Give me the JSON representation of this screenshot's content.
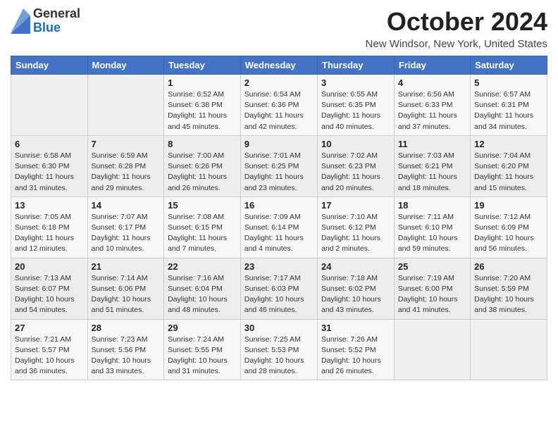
{
  "header": {
    "logo": {
      "general": "General",
      "blue": "Blue"
    },
    "title": "October 2024",
    "location": "New Windsor, New York, United States"
  },
  "weekdays": [
    "Sunday",
    "Monday",
    "Tuesday",
    "Wednesday",
    "Thursday",
    "Friday",
    "Saturday"
  ],
  "weeks": [
    [
      null,
      null,
      {
        "day": 1,
        "sunrise": "Sunrise: 6:52 AM",
        "sunset": "Sunset: 6:38 PM",
        "daylight": "Daylight: 11 hours and 45 minutes."
      },
      {
        "day": 2,
        "sunrise": "Sunrise: 6:54 AM",
        "sunset": "Sunset: 6:36 PM",
        "daylight": "Daylight: 11 hours and 42 minutes."
      },
      {
        "day": 3,
        "sunrise": "Sunrise: 6:55 AM",
        "sunset": "Sunset: 6:35 PM",
        "daylight": "Daylight: 11 hours and 40 minutes."
      },
      {
        "day": 4,
        "sunrise": "Sunrise: 6:56 AM",
        "sunset": "Sunset: 6:33 PM",
        "daylight": "Daylight: 11 hours and 37 minutes."
      },
      {
        "day": 5,
        "sunrise": "Sunrise: 6:57 AM",
        "sunset": "Sunset: 6:31 PM",
        "daylight": "Daylight: 11 hours and 34 minutes."
      }
    ],
    [
      {
        "day": 6,
        "sunrise": "Sunrise: 6:58 AM",
        "sunset": "Sunset: 6:30 PM",
        "daylight": "Daylight: 11 hours and 31 minutes."
      },
      {
        "day": 7,
        "sunrise": "Sunrise: 6:59 AM",
        "sunset": "Sunset: 6:28 PM",
        "daylight": "Daylight: 11 hours and 29 minutes."
      },
      {
        "day": 8,
        "sunrise": "Sunrise: 7:00 AM",
        "sunset": "Sunset: 6:26 PM",
        "daylight": "Daylight: 11 hours and 26 minutes."
      },
      {
        "day": 9,
        "sunrise": "Sunrise: 7:01 AM",
        "sunset": "Sunset: 6:25 PM",
        "daylight": "Daylight: 11 hours and 23 minutes."
      },
      {
        "day": 10,
        "sunrise": "Sunrise: 7:02 AM",
        "sunset": "Sunset: 6:23 PM",
        "daylight": "Daylight: 11 hours and 20 minutes."
      },
      {
        "day": 11,
        "sunrise": "Sunrise: 7:03 AM",
        "sunset": "Sunset: 6:21 PM",
        "daylight": "Daylight: 11 hours and 18 minutes."
      },
      {
        "day": 12,
        "sunrise": "Sunrise: 7:04 AM",
        "sunset": "Sunset: 6:20 PM",
        "daylight": "Daylight: 11 hours and 15 minutes."
      }
    ],
    [
      {
        "day": 13,
        "sunrise": "Sunrise: 7:05 AM",
        "sunset": "Sunset: 6:18 PM",
        "daylight": "Daylight: 11 hours and 12 minutes."
      },
      {
        "day": 14,
        "sunrise": "Sunrise: 7:07 AM",
        "sunset": "Sunset: 6:17 PM",
        "daylight": "Daylight: 11 hours and 10 minutes."
      },
      {
        "day": 15,
        "sunrise": "Sunrise: 7:08 AM",
        "sunset": "Sunset: 6:15 PM",
        "daylight": "Daylight: 11 hours and 7 minutes."
      },
      {
        "day": 16,
        "sunrise": "Sunrise: 7:09 AM",
        "sunset": "Sunset: 6:14 PM",
        "daylight": "Daylight: 11 hours and 4 minutes."
      },
      {
        "day": 17,
        "sunrise": "Sunrise: 7:10 AM",
        "sunset": "Sunset: 6:12 PM",
        "daylight": "Daylight: 11 hours and 2 minutes."
      },
      {
        "day": 18,
        "sunrise": "Sunrise: 7:11 AM",
        "sunset": "Sunset: 6:10 PM",
        "daylight": "Daylight: 10 hours and 59 minutes."
      },
      {
        "day": 19,
        "sunrise": "Sunrise: 7:12 AM",
        "sunset": "Sunset: 6:09 PM",
        "daylight": "Daylight: 10 hours and 56 minutes."
      }
    ],
    [
      {
        "day": 20,
        "sunrise": "Sunrise: 7:13 AM",
        "sunset": "Sunset: 6:07 PM",
        "daylight": "Daylight: 10 hours and 54 minutes."
      },
      {
        "day": 21,
        "sunrise": "Sunrise: 7:14 AM",
        "sunset": "Sunset: 6:06 PM",
        "daylight": "Daylight: 10 hours and 51 minutes."
      },
      {
        "day": 22,
        "sunrise": "Sunrise: 7:16 AM",
        "sunset": "Sunset: 6:04 PM",
        "daylight": "Daylight: 10 hours and 48 minutes."
      },
      {
        "day": 23,
        "sunrise": "Sunrise: 7:17 AM",
        "sunset": "Sunset: 6:03 PM",
        "daylight": "Daylight: 10 hours and 46 minutes."
      },
      {
        "day": 24,
        "sunrise": "Sunrise: 7:18 AM",
        "sunset": "Sunset: 6:02 PM",
        "daylight": "Daylight: 10 hours and 43 minutes."
      },
      {
        "day": 25,
        "sunrise": "Sunrise: 7:19 AM",
        "sunset": "Sunset: 6:00 PM",
        "daylight": "Daylight: 10 hours and 41 minutes."
      },
      {
        "day": 26,
        "sunrise": "Sunrise: 7:20 AM",
        "sunset": "Sunset: 5:59 PM",
        "daylight": "Daylight: 10 hours and 38 minutes."
      }
    ],
    [
      {
        "day": 27,
        "sunrise": "Sunrise: 7:21 AM",
        "sunset": "Sunset: 5:57 PM",
        "daylight": "Daylight: 10 hours and 36 minutes."
      },
      {
        "day": 28,
        "sunrise": "Sunrise: 7:23 AM",
        "sunset": "Sunset: 5:56 PM",
        "daylight": "Daylight: 10 hours and 33 minutes."
      },
      {
        "day": 29,
        "sunrise": "Sunrise: 7:24 AM",
        "sunset": "Sunset: 5:55 PM",
        "daylight": "Daylight: 10 hours and 31 minutes."
      },
      {
        "day": 30,
        "sunrise": "Sunrise: 7:25 AM",
        "sunset": "Sunset: 5:53 PM",
        "daylight": "Daylight: 10 hours and 28 minutes."
      },
      {
        "day": 31,
        "sunrise": "Sunrise: 7:26 AM",
        "sunset": "Sunset: 5:52 PM",
        "daylight": "Daylight: 10 hours and 26 minutes."
      },
      null,
      null
    ]
  ]
}
